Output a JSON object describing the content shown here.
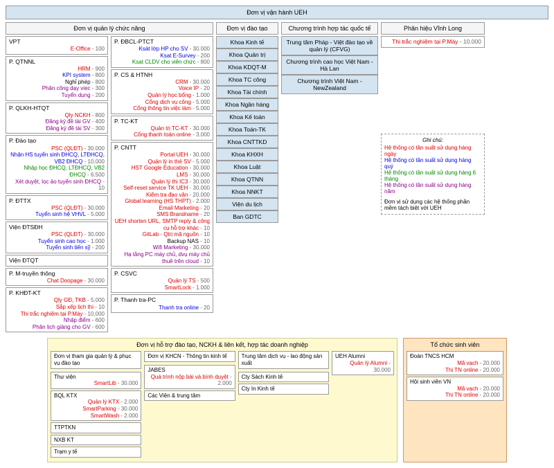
{
  "header": "Đơn vị vận hành UEH",
  "sec1_title": "Đơn vị quản lý chức năng",
  "sec2_title": "Đơn vị đào tạo",
  "sec3_title": "Chương trình hợp tác quốc tế",
  "sec4_title": "Phân hiệu Vĩnh Long",
  "sec4_item": "Thi trắc nghiệm tại P.Máy",
  "sec4_num": " - 10.000",
  "col1": [
    {
      "name": "VPT",
      "items": [
        {
          "t": "E-Office",
          "c": "red",
          "n": " - 100"
        }
      ]
    },
    {
      "name": "P. QTNNL",
      "items": [
        {
          "t": "HRM",
          "c": "red",
          "n": " - 900"
        },
        {
          "t": "KPI system",
          "c": "blue",
          "n": " - 800"
        },
        {
          "t": "Nghỉ phép",
          "c": "black",
          "n": " - 800"
        },
        {
          "t": "Phân công dạy viẹc",
          "c": "purple",
          "n": " - 300"
        },
        {
          "t": "Tuyển dụng",
          "c": "purple",
          "n": " - 200"
        }
      ]
    },
    {
      "name": "P. QLKH-HTQT",
      "items": [
        {
          "t": "Qly NCKH",
          "c": "red",
          "n": " - 800"
        },
        {
          "t": "Đăng ký đề tài GV",
          "c": "purple",
          "n": " - 400"
        },
        {
          "t": "Đăng ký đề tài SV",
          "c": "purple",
          "n": " - 300"
        }
      ]
    },
    {
      "name": "P. Đào tạo",
      "items": [
        {
          "t": "PSC (QLĐT)",
          "c": "red",
          "n": " - 30.000"
        },
        {
          "t": "Nhận HS tuyển sinh ĐHCQ, LTĐHCQ, VB2 ĐHCQ",
          "c": "blue",
          "n": " - 10.000"
        },
        {
          "t": "Nhập học ĐHCQ, LTĐHCQ, VB2 ĐHCQ",
          "c": "green",
          "n": " - 6.500"
        },
        {
          "t": "Xét duyệt, lọc ảo tuyển sinh ĐHCQ",
          "c": "purple",
          "n": " - 10"
        }
      ]
    },
    {
      "name": "P. ĐTTX",
      "items": [
        {
          "t": "PSC (QLĐT)",
          "c": "red",
          "n": " - 30.000"
        },
        {
          "t": "Tuyển sinh hệ VHVL",
          "c": "blue",
          "n": " - 5.000"
        }
      ]
    },
    {
      "name": "Viện ĐTSĐH",
      "items": [
        {
          "t": "PSC (QLĐT)",
          "c": "red",
          "n": " - 30.000"
        },
        {
          "t": "Tuyển sinh cao học",
          "c": "blue",
          "n": " - 1.000"
        },
        {
          "t": "Tuyển sinh tiến sỹ",
          "c": "blue",
          "n": " - 200"
        }
      ]
    },
    {
      "name": "Viện ĐTQT",
      "items": []
    },
    {
      "name": "P. M-truyền thông",
      "items": [
        {
          "t": "Chat Doopage",
          "c": "red",
          "n": " - 30.000"
        }
      ]
    },
    {
      "name": "P. KHĐT-KT",
      "items": [
        {
          "t": "Qly GĐ, TKB",
          "c": "red",
          "n": " - 5.000"
        },
        {
          "t": "Sắp xếp lịch thi",
          "c": "red",
          "n": " - 10"
        },
        {
          "t": "Thi trắc nghiệm tại P.Máy",
          "c": "red",
          "n": " - 10.000"
        },
        {
          "t": "Nhập điểm",
          "c": "purple",
          "n": " - 600"
        },
        {
          "t": "Phân lịch giảng cho GV",
          "c": "purple",
          "n": " - 600"
        }
      ]
    }
  ],
  "col2": [
    {
      "name": "P. ĐBCL-PTCT",
      "items": [
        {
          "t": "Ksát lớp HP cho SV",
          "c": "blue",
          "n": " - 30.000"
        },
        {
          "t": "Ksat E-Survey",
          "c": "blue",
          "n": " - 200"
        },
        {
          "t": "Ksat CLDV cho viên chức",
          "c": "green",
          "n": " - 800"
        }
      ]
    },
    {
      "name": "P. CS & HTNH",
      "items": [
        {
          "t": "CRM",
          "c": "red",
          "n": " - 30.000"
        },
        {
          "t": "Voice IP",
          "c": "red",
          "n": " - 20"
        },
        {
          "t": "Quản lý học bổng",
          "c": "red",
          "n": " - 1.000"
        },
        {
          "t": "Cổng dịch vụ công",
          "c": "red",
          "n": " - 5.000"
        },
        {
          "t": "Cổng thông tin việc làm",
          "c": "red",
          "n": " - 5.000"
        }
      ]
    },
    {
      "name": "P. TC-KT",
      "items": [
        {
          "t": "Quản trị TC-KT",
          "c": "red",
          "n": " - 30.000"
        },
        {
          "t": "Cổng thanh toán online",
          "c": "red",
          "n": " - 3.000"
        }
      ]
    },
    {
      "name": "P. CNTT",
      "items": [
        {
          "t": "Portal UEH",
          "c": "red",
          "n": " - 30.000"
        },
        {
          "t": "Quản lý in thẻ SV",
          "c": "red",
          "n": " - 5.000"
        },
        {
          "t": "HST Google Education",
          "c": "red",
          "n": " - 30.000"
        },
        {
          "t": "LMS",
          "c": "red",
          "n": " - 30.000"
        },
        {
          "t": "Quản lý thi IC3",
          "c": "red",
          "n": " - 30.000"
        },
        {
          "t": "Self-reset service TK UEH",
          "c": "red",
          "n": " - 30.000"
        },
        {
          "t": "Kiểm tra đạo văn",
          "c": "red",
          "n": " - 20.000"
        },
        {
          "t": "Global learning (HS THPT)",
          "c": "red",
          "n": " - 2.000"
        },
        {
          "t": "Email Marketing",
          "c": "red",
          "n": " - 20"
        },
        {
          "t": "SMS Brandname",
          "c": "red",
          "n": " - 20"
        },
        {
          "t": "UEH shorten URL, SMTP reply & công cụ hỗ trợ khác",
          "c": "red",
          "n": " - 10"
        },
        {
          "t": "GitLab - Qtrị mã nguồn",
          "c": "red",
          "n": " - 10"
        },
        {
          "t": "Backup NAS",
          "c": "black",
          "n": " - 10"
        },
        {
          "t": "Wifi Marketing",
          "c": "purple",
          "n": " - 30.000"
        },
        {
          "t": "Hạ tầng PC máy chủ, dvụ máy chủ thuê trên cloud",
          "c": "purple",
          "n": " - 10"
        }
      ]
    },
    {
      "name": "P. CSVC",
      "items": [
        {
          "t": "Quản lý TS",
          "c": "red",
          "n": " - 500"
        },
        {
          "t": "SmartLock",
          "c": "red",
          "n": " - 1.000"
        }
      ]
    },
    {
      "name": "P. Thanh tra-PC",
      "items": [
        {
          "t": "Thanh tra online",
          "c": "blue",
          "n": " - 20"
        }
      ]
    }
  ],
  "training_units": [
    "Khoa Kinh tế",
    "Khoa Quản trị",
    "Khoa KDQT-M",
    "Khoa TC công",
    "Khoa Tài chính",
    "Khoa Ngân hàng",
    "Khoa Kế toán",
    "Khoa Toán-TK",
    "Khoa CNTTKD",
    "Khoa KHXH",
    "Khoa Luật",
    "Khoa QTNN",
    "Khoa NNKT",
    "Viện du lịch",
    "Ban GDTC"
  ],
  "intl": [
    "Trung tâm Pháp - Việt đào tạo về quản lý (CFVG)",
    "Chương trình cao học Việt Nam - Hà Lan",
    "Chương trình Việt Nam - NewZealand"
  ],
  "legend": {
    "title": "Ghi chú:",
    "l1": "Hệ thống có tần suất sử dụng hàng ngày",
    "l2": "Hệ thống có tần suất sử dụng hàng quý",
    "l3": "Hệ thống có tần suất sử dụng hàng 6 tháng",
    "l4": "Hệ thống có tần suất sử dụng hàng năm",
    "note": "Đơn vị sử dụng các hệ thống phần mềm tách biệt với UEH"
  },
  "bottom_left_title": "Đơn vị hỗ trợ đào tạo, NCKH & liên kết, hợp tác doanh nghiệp",
  "bottom_right_title": "Tổ chức sinh viên",
  "b_col1_title": "Đơn vị tham gia quản lý & phục vụ đào tạo",
  "b_col1": [
    {
      "name": "Thư viện",
      "items": [
        {
          "t": "SmartLib",
          "c": "red",
          "n": " - 30.000"
        }
      ]
    },
    {
      "name": "BQL KTX",
      "items": [
        {
          "t": "Quản lý KTX",
          "c": "red",
          "n": " - 2.000"
        },
        {
          "t": "SmartParking",
          "c": "red",
          "n": " - 30.000"
        },
        {
          "t": "SmartWash",
          "c": "red",
          "n": " - 2.000"
        }
      ]
    },
    {
      "name": "TTPTKN",
      "items": []
    },
    {
      "name": "NXB KT",
      "items": []
    },
    {
      "name": "Trạm y tế",
      "items": []
    }
  ],
  "b_col2_title": "Đơn vị KHCN - Thông tin kinh tế",
  "b_col2": [
    {
      "name": "JABES",
      "items": [
        {
          "t": "Quá trình nộp bài và bình duyệt",
          "c": "red",
          "n": " - 2.000"
        }
      ]
    },
    {
      "name": "Các Viện & trung tâm",
      "items": []
    }
  ],
  "b_col3_title": "Trung tâm dịch vụ - lao động sản xuất",
  "b_col3": [
    {
      "name": "Cty Sách Kinh tế",
      "items": []
    },
    {
      "name": "Cty In Kinh tế",
      "items": []
    }
  ],
  "b_col4_title": "UEH Alumni",
  "b_col4_item": "Quản lý Alumni",
  "b_col4_num": " - 30.000",
  "sv_units": [
    {
      "name": "Đoàn TNCS HCM",
      "items": [
        {
          "t": "Mã vạch",
          "c": "red",
          "n": " - 20.000"
        },
        {
          "t": "Thi TN online",
          "c": "red",
          "n": " - 20.000"
        }
      ]
    },
    {
      "name": "Hội sinh viên VN",
      "items": [
        {
          "t": "Mã vạch",
          "c": "red",
          "n": " - 20.000"
        },
        {
          "t": "Thi TN online",
          "c": "red",
          "n": " - 20.000"
        }
      ]
    }
  ]
}
